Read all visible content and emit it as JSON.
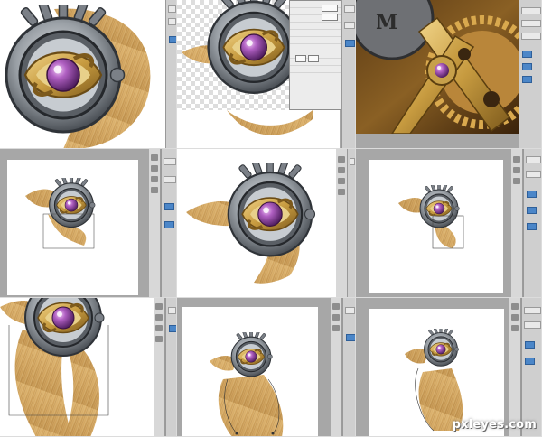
{
  "collage": {
    "tiles": [
      {
        "id": "tile-1",
        "state": "zoomed eye with hair"
      },
      {
        "id": "tile-2",
        "state": "transparent layer with dialog"
      },
      {
        "id": "tile-3",
        "state": "gear close-up photo"
      },
      {
        "id": "tile-4",
        "state": "small eye, hair outline"
      },
      {
        "id": "tile-5",
        "state": "eye with ear, medium"
      },
      {
        "id": "tile-6",
        "state": "small eye on large canvas"
      },
      {
        "id": "tile-7",
        "state": "long hair zoom"
      },
      {
        "id": "tile-8",
        "state": "hair with bezier path"
      },
      {
        "id": "tile-9",
        "state": "hair with bezier path 2"
      }
    ]
  },
  "gear_photo": {
    "letter": "M"
  },
  "watermark": {
    "text": "pxleyes.com"
  },
  "colors": {
    "wood": "#d4a865",
    "wood_dark": "#b48643",
    "metal": "#8a8f95",
    "metal_dark": "#3e4247",
    "brass": "#c9a24a",
    "jewel": "#8a3f9c",
    "ui_gray": "#a7a7a7",
    "ui_blue": "#4b86c8"
  }
}
